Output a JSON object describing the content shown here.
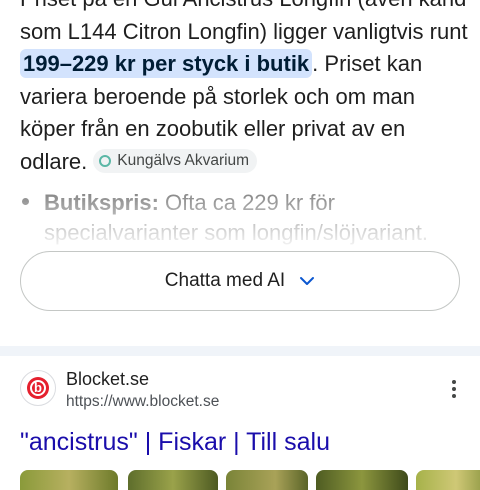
{
  "ai_overview": {
    "line1": "Priset på en Gul Ancistrus Longfin (även känd",
    "line2": "som L144 Citron Longfin) ligger vanligtvis runt",
    "highlight": "199–229 kr per styck i butik",
    "after_highlight": ". Priset kan",
    "line4": "variera beroende på storlek och om man",
    "line5": "köper från en zoobutik eller privat av en",
    "line6": "odlare.",
    "source_chip": "Kungälvs Akvarium",
    "bullet_label": "Butikspris:",
    "bullet_text": " Ofta ca 229 kr för",
    "bullet_line2": "specialvarianter som longfin/slöjvariant.",
    "chat_button": "Chatta med AI"
  },
  "result": {
    "site_name": "Blocket.se",
    "url": "https://www.blocket.se",
    "title": "\"ancistrus\" | Fiskar | Till salu",
    "favicon_letter": "b",
    "favicon_color": "#e5202e"
  },
  "colors": {
    "highlight_bg": "#d3e3fd",
    "link": "#1a0dab",
    "divider": "#f0f4f9"
  }
}
